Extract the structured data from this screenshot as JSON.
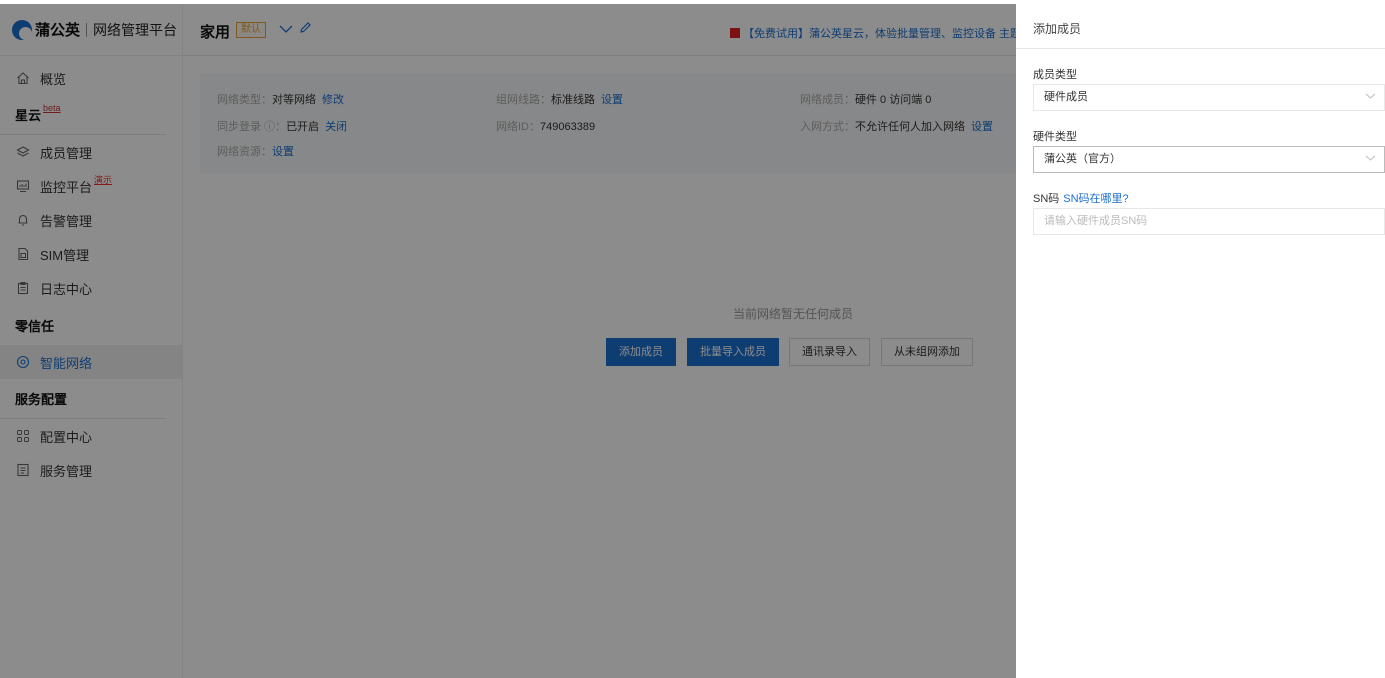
{
  "brand": {
    "name": "蒲公英",
    "subtitle": "网络管理平台",
    "color": "#1a6fcf"
  },
  "sidebar": {
    "items": [
      {
        "label": "概览",
        "icon": "home-icon"
      },
      {
        "section": "星云",
        "badge": "beta"
      },
      {
        "label": "成员管理",
        "icon": "layers-icon"
      },
      {
        "label": "监控平台",
        "icon": "monitor-icon",
        "badge": "演示"
      },
      {
        "label": "告警管理",
        "icon": "bell-icon"
      },
      {
        "label": "SIM管理",
        "icon": "sim-icon"
      },
      {
        "label": "日志中心",
        "icon": "clipboard-icon"
      },
      {
        "section": "零信任"
      },
      {
        "label": "智能网络",
        "icon": "network-icon",
        "active": true
      },
      {
        "section": "服务配置"
      },
      {
        "label": "配置中心",
        "icon": "grid-icon"
      },
      {
        "label": "服务管理",
        "icon": "list-icon"
      }
    ]
  },
  "header": {
    "network_name": "家用",
    "default_tag": "默认",
    "promo": "【免费试用】蒲公英星云，体验批量管理、监控设备  主题"
  },
  "info": {
    "net_type_label": "网络类型：",
    "net_type_value": "对等网络",
    "net_type_action": "修改",
    "route_label": "组网线路：",
    "route_value": "标准线路",
    "route_action": "设置",
    "members_label": "网络成员：",
    "members_value": "硬件 0   访问端 0",
    "sync_label": "同步登录 ⓘ：",
    "sync_value": "已开启",
    "sync_action": "关闭",
    "id_label": "网络ID：",
    "id_value": "749063389",
    "join_label": "入网方式：",
    "join_value": "不允许任何人加入网络",
    "join_action": "设置",
    "res_label": "网络资源：",
    "res_action": "设置"
  },
  "empty": {
    "message": "当前网络暂无任何成员",
    "buttons": [
      "添加成员",
      "批量导入成员",
      "通讯录导入",
      "从未组网添加"
    ]
  },
  "drawer": {
    "title": "添加成员",
    "member_type_label": "成员类型",
    "member_type_value": "硬件成员",
    "hw_type_label": "硬件类型",
    "hw_type_value": "蒲公英（官方）",
    "sn_label": "SN码",
    "sn_help": "SN码在哪里?",
    "sn_placeholder": "请输入硬件成员SN码"
  }
}
